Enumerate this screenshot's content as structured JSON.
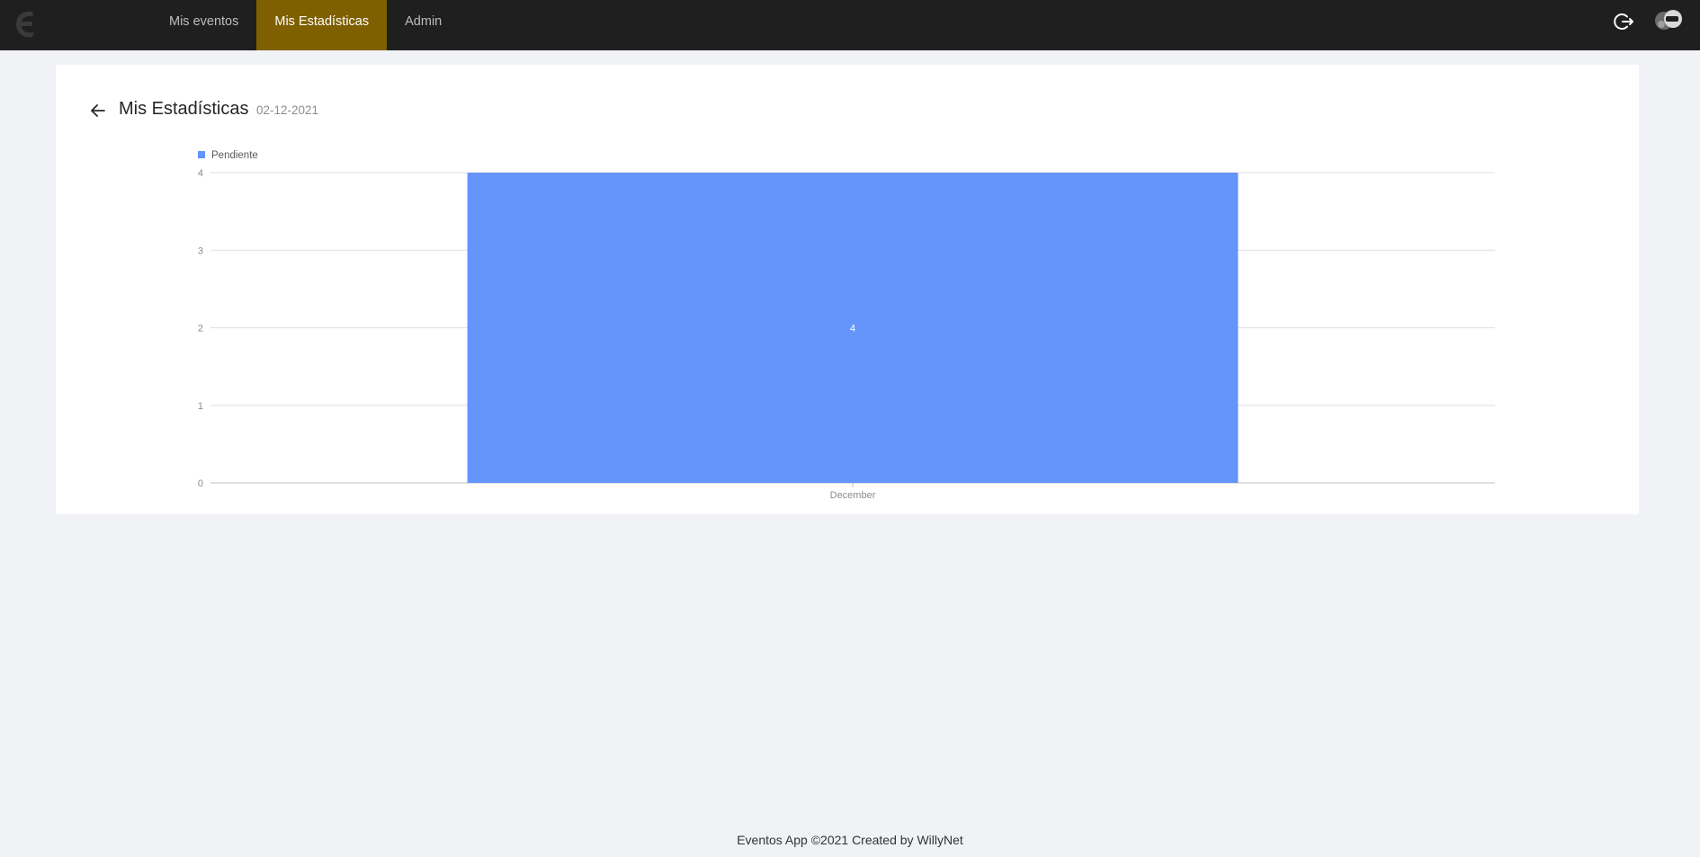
{
  "nav": {
    "items": [
      {
        "label": "Mis eventos",
        "active": false
      },
      {
        "label": "Mis Estadísticas",
        "active": true
      },
      {
        "label": "Admin",
        "active": false
      }
    ]
  },
  "header_icons": {
    "logo": "logo-e-icon",
    "logout": "logout-icon",
    "avatar": "avatar"
  },
  "page": {
    "title": "Mis Estadísticas",
    "subtitle": "02-12-2021"
  },
  "colors": {
    "topbar": "#1f1f1f",
    "accent": "#7f6000",
    "bar": "#6395fa"
  },
  "chart_data": {
    "type": "bar",
    "categories": [
      "December"
    ],
    "series": [
      {
        "name": "Pendiente",
        "values": [
          4
        ],
        "color": "#6395fa"
      }
    ],
    "ylim": [
      0,
      4
    ],
    "yticks": [
      0,
      1,
      2,
      3,
      4
    ],
    "grid": true,
    "legend": "top-left",
    "data_labels": true
  },
  "footer": {
    "text": "Eventos App ©2021 Created by WillyNet"
  }
}
